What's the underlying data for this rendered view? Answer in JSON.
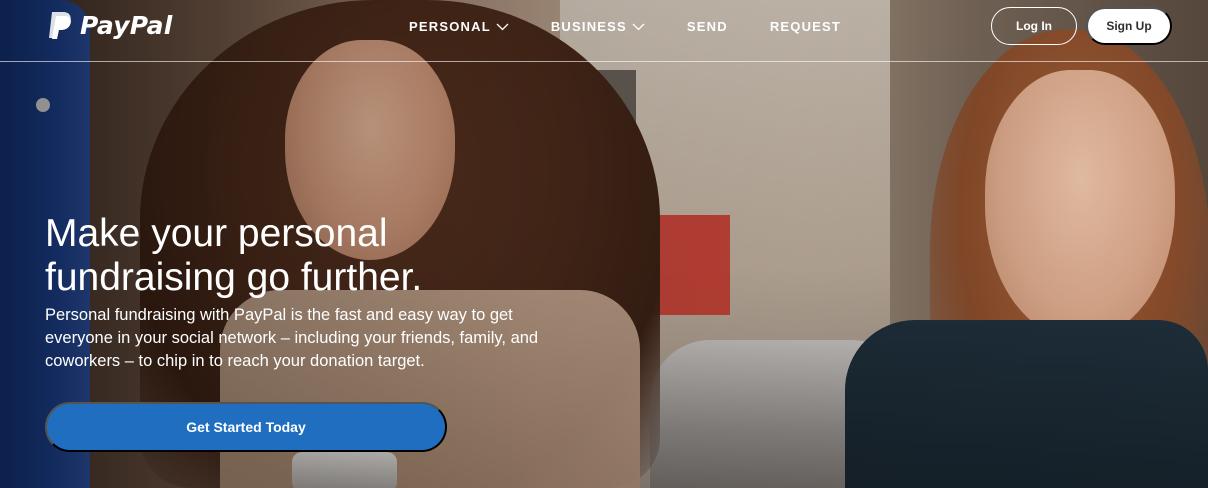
{
  "header": {
    "logo_text": "PayPal",
    "nav": [
      {
        "label": "PERSONAL",
        "has_dropdown": true
      },
      {
        "label": "BUSINESS",
        "has_dropdown": true
      },
      {
        "label": "SEND",
        "has_dropdown": false
      },
      {
        "label": "REQUEST",
        "has_dropdown": false
      }
    ],
    "login_label": "Log In",
    "signup_label": "Sign Up"
  },
  "hero": {
    "headline_line1": "Make your personal",
    "headline_line2": "fundraising go further.",
    "subcopy": "Personal fundraising with PayPal is the fast and easy way to get everyone in your social network – including your friends, family, and coworkers – to chip in to reach your donation target.",
    "cta_label": "Get Started Today"
  },
  "colors": {
    "cta": "#1f6ebf",
    "text": "#ffffff",
    "signup_text": "#2c2e2f"
  },
  "icons": {
    "logo": "paypal-logo-icon",
    "dropdown": "chevron-down-icon"
  }
}
